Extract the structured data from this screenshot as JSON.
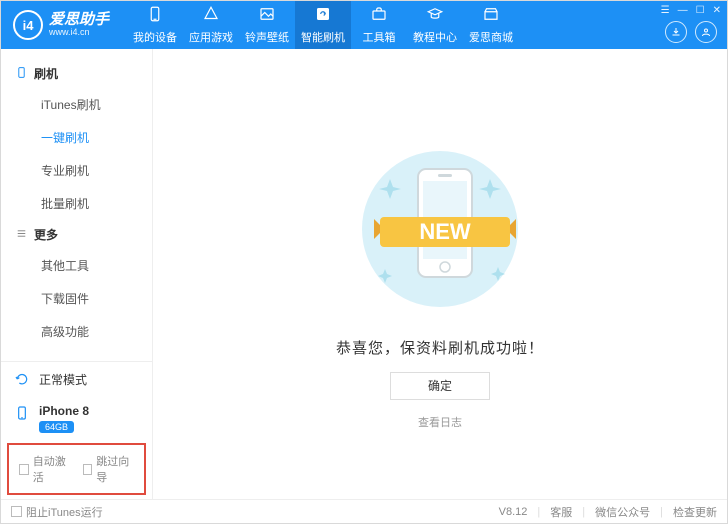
{
  "brand": {
    "logo_text": "i4",
    "title": "爱思助手",
    "subtitle": "www.i4.cn"
  },
  "tabs": [
    {
      "label": "我的设备"
    },
    {
      "label": "应用游戏"
    },
    {
      "label": "铃声壁纸"
    },
    {
      "label": "智能刷机"
    },
    {
      "label": "工具箱"
    },
    {
      "label": "教程中心"
    },
    {
      "label": "爱思商城"
    }
  ],
  "sidebar": {
    "section1": {
      "title": "刷机",
      "items": [
        "iTunes刷机",
        "一键刷机",
        "专业刷机",
        "批量刷机"
      ]
    },
    "section2": {
      "title": "更多",
      "items": [
        "其他工具",
        "下载固件",
        "高级功能"
      ]
    },
    "mode_label": "正常模式",
    "device": {
      "name": "iPhone 8",
      "badge": "64GB"
    },
    "auto_activate": "自动激活",
    "skip_wizard": "跳过向导"
  },
  "main": {
    "ribbon_text": "NEW",
    "message": "恭喜您，保资料刷机成功啦！",
    "ok": "确定",
    "view_log": "查看日志"
  },
  "footer": {
    "block_itunes": "阻止iTunes运行",
    "version": "V8.12",
    "support": "客服",
    "wechat": "微信公众号",
    "update": "检查更新"
  }
}
